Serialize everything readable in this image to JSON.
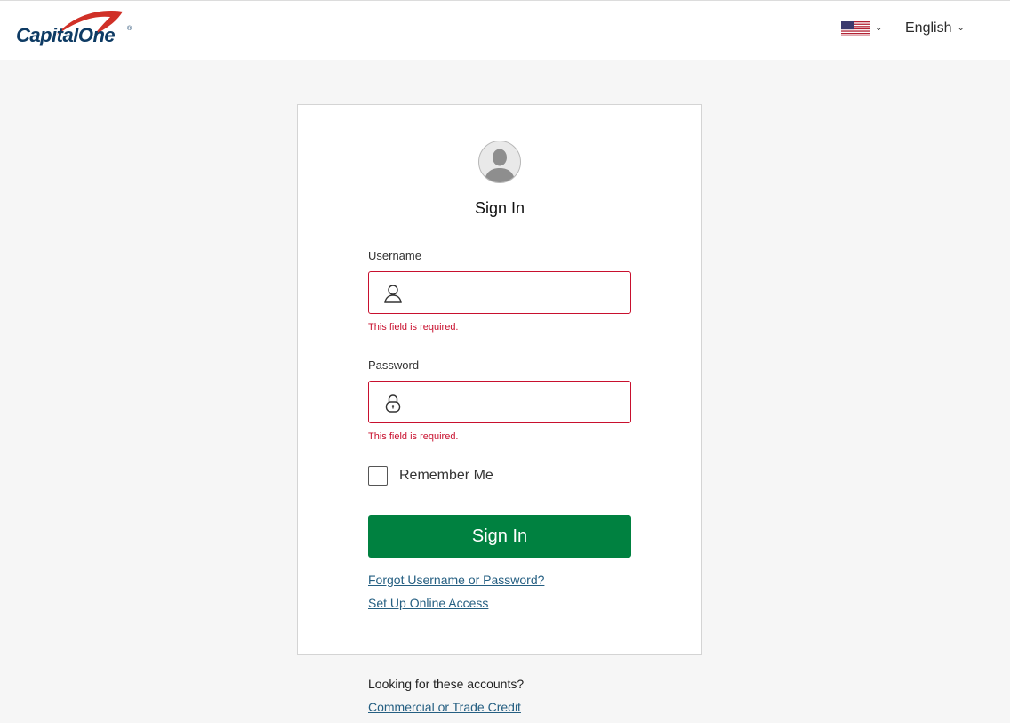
{
  "header": {
    "logo_text": "CapitalOne",
    "logo_registered": "®",
    "country_chevron": "⌄",
    "language_label": "English",
    "language_chevron": "⌄",
    "brand_colors": {
      "navy": "#0e3b64",
      "red": "#d03027"
    }
  },
  "signin_card": {
    "title": "Sign In",
    "username": {
      "label": "Username",
      "value": "",
      "icon": "user-icon",
      "error": "This field is required."
    },
    "password": {
      "label": "Password",
      "value": "",
      "icon": "lock-icon",
      "error": "This field is required."
    },
    "remember_me": {
      "label": "Remember Me",
      "checked": false
    },
    "submit_label": "Sign In",
    "links": {
      "forgot": "Forgot Username or Password?",
      "setup": "Set Up Online Access"
    }
  },
  "footer": {
    "prompt": "Looking for these accounts?",
    "link": "Commercial or Trade Credit"
  },
  "colors": {
    "primary_button": "#008140",
    "error": "#c8102e",
    "link": "#255f82",
    "page_background": "#f6f6f6"
  }
}
